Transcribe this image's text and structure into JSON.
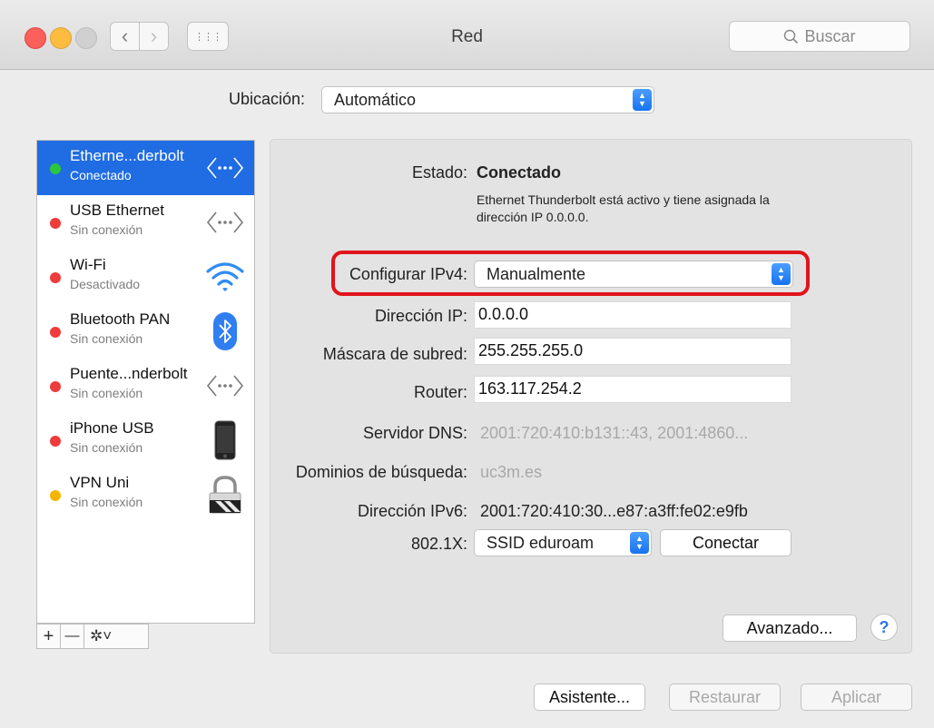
{
  "window": {
    "title": "Red"
  },
  "toolbar": {
    "back_label": "‹",
    "forward_label": "›",
    "grid_label": "⋮⋮⋮",
    "search_placeholder": "Buscar"
  },
  "location": {
    "label": "Ubicación:",
    "value": "Automático"
  },
  "services": [
    {
      "name": "Etherne...derbolt",
      "status": "Conectado",
      "status_color": "#2cc63c",
      "icon": "ethernet-icon",
      "selected": true
    },
    {
      "name": "USB Ethernet",
      "status": "Sin conexión",
      "status_color": "#ef3b3b",
      "icon": "ethernet-icon"
    },
    {
      "name": "Wi-Fi",
      "status": "Desactivado",
      "status_color": "#ef3b3b",
      "icon": "wifi-icon"
    },
    {
      "name": "Bluetooth PAN",
      "status": "Sin conexión",
      "status_color": "#ef3b3b",
      "icon": "bluetooth-icon"
    },
    {
      "name": "Puente...nderbolt",
      "status": "Sin conexión",
      "status_color": "#ef3b3b",
      "icon": "ethernet-icon"
    },
    {
      "name": "iPhone USB",
      "status": "Sin conexión",
      "status_color": "#ef3b3b",
      "icon": "iphone-icon"
    },
    {
      "name": "VPN Uni",
      "status": "Sin conexión",
      "status_color": "#f5b400",
      "icon": "vpn-lock-icon"
    }
  ],
  "sidebar_tools": {
    "add": "+",
    "remove": "—",
    "gear": "✲˅"
  },
  "details": {
    "status_label": "Estado:",
    "status_value": "Conectado",
    "status_desc_line1": "Ethernet Thunderbolt está activo y tiene asignada la",
    "status_desc_line2": "dirección IP 0.0.0.0.",
    "configure_label": "Configurar IPv4:",
    "configure_value": "Manualmente",
    "ip_label": "Dirección IP:",
    "ip_value": "0.0.0.0",
    "mask_label": "Máscara de subred:",
    "mask_value": "255.255.255.0",
    "router_label": "Router:",
    "router_value": "163.117.254.2",
    "dns_label": "Servidor DNS:",
    "dns_value": "2001:720:410:b131::43, 2001:4860...",
    "search_domains_label": "Dominios de búsqueda:",
    "search_domains_value": "uc3m.es",
    "ipv6_label": "Dirección IPv6:",
    "ipv6_value": "2001:720:410:30...e87:a3ff:fe02:e9fb",
    "dot1x_label": "802.1X:",
    "dot1x_value": "SSID eduroam",
    "connect_button": "Conectar",
    "advanced_button": "Avanzado...",
    "help_button": "?"
  },
  "footer": {
    "assistant": "Asistente...",
    "revert": "Restaurar",
    "apply": "Aplicar"
  },
  "colors": {
    "selection": "#1f6ce3",
    "highlight": "#e0141c",
    "accent": "#1773f0"
  }
}
